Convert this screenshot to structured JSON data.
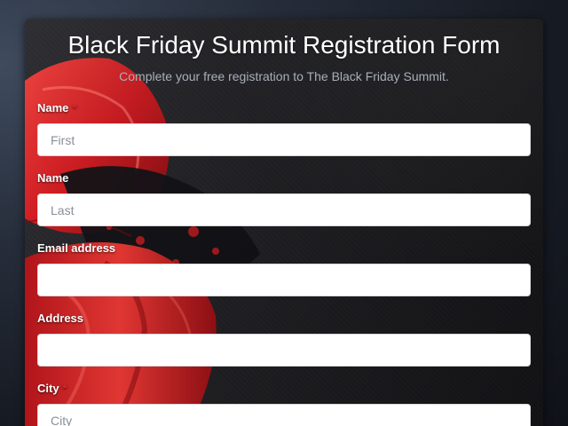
{
  "form": {
    "title": "Black Friday Summit Registration Form",
    "subtitle": "Complete your free registration to The Black Friday Summit.",
    "required_marker": "*",
    "fields": [
      {
        "label": "Name",
        "required": true,
        "value": "",
        "placeholder": "First"
      },
      {
        "label": "Name",
        "required": false,
        "value": "",
        "placeholder": "Last"
      },
      {
        "label": "Email address",
        "required": false,
        "value": "",
        "placeholder": ""
      },
      {
        "label": "Address",
        "required": false,
        "value": "",
        "placeholder": ""
      },
      {
        "label": "City",
        "required": true,
        "value": "",
        "placeholder": "City"
      }
    ]
  },
  "colors": {
    "required_marker": "#e0262e",
    "ribbon_red": "#e3242b",
    "card_background": "#26262a"
  }
}
